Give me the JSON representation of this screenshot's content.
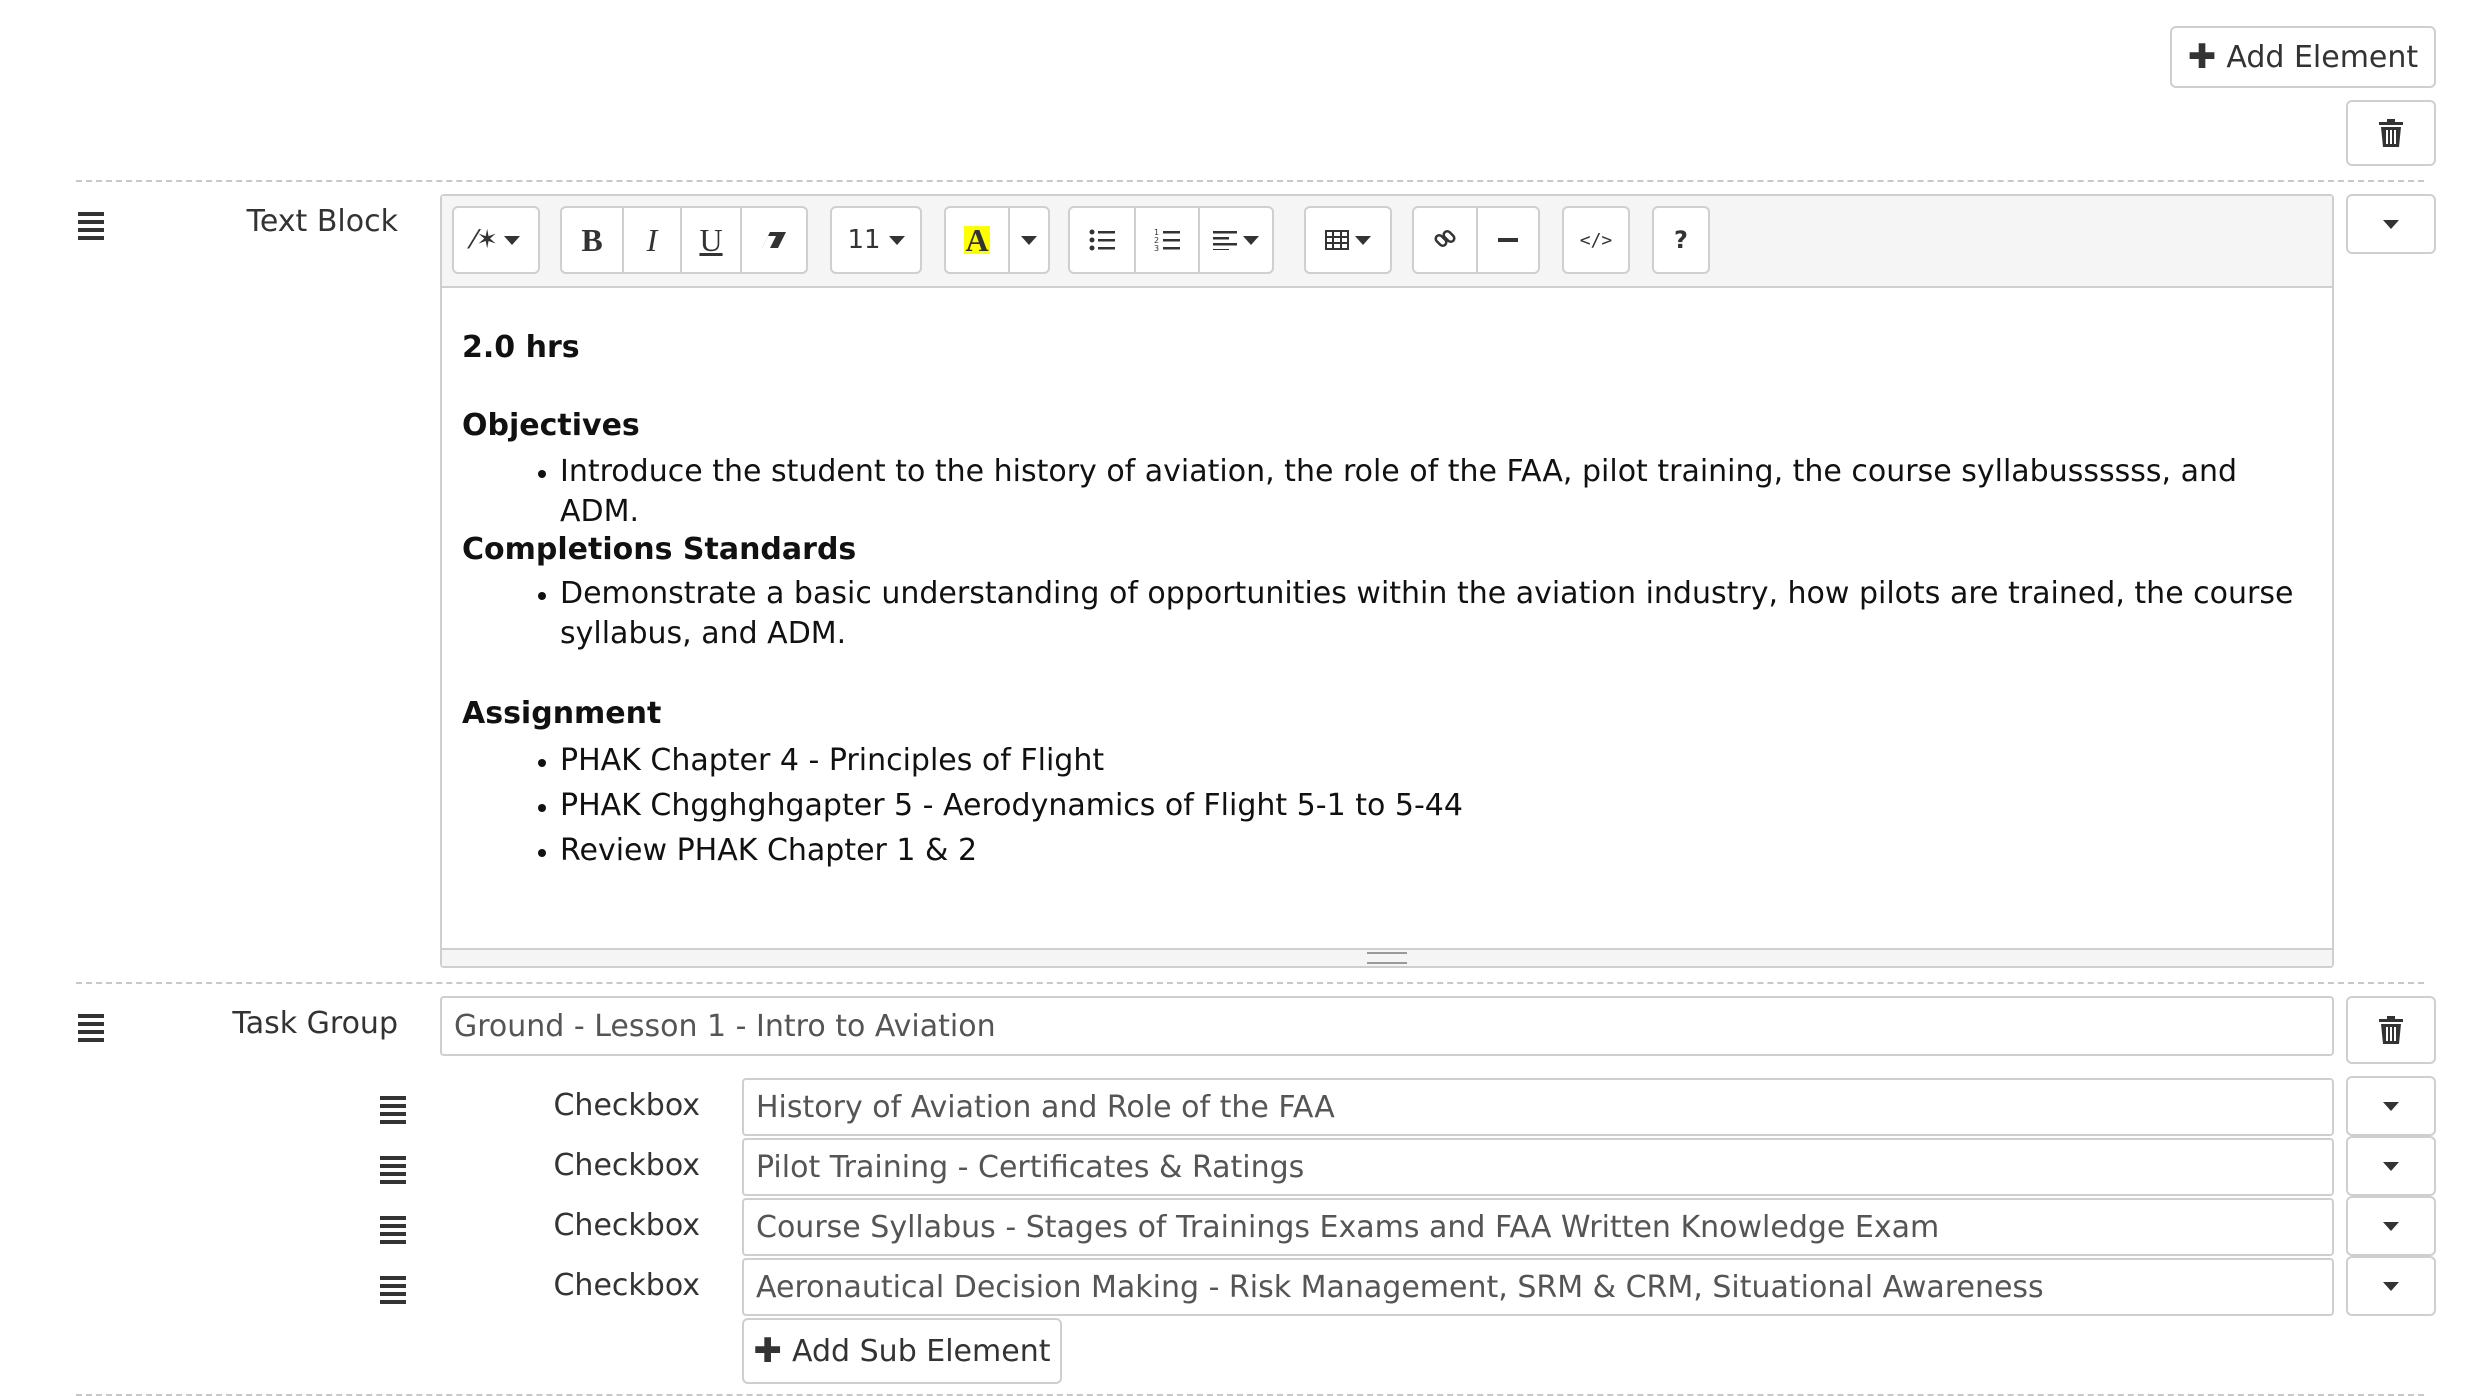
{
  "top": {
    "add_element_label": "Add Element"
  },
  "text_block": {
    "label": "Text Block",
    "toolbar": {
      "font_size": "11",
      "highlight_letter": "A",
      "help_label": "?"
    },
    "content": {
      "duration": "2.0 hrs",
      "objectives_heading": "Objectives",
      "objectives": [
        "Introduce the student to the history of aviation, the role of the FAA, pilot training, the course syllabussssss, and ADM."
      ],
      "standards_heading": "Completions Standards",
      "standards": [
        "Demonstrate a basic understanding of opportunities within the aviation industry, how pilots are trained, the course syllabus, and ADM."
      ],
      "assignment_heading": "Assignment",
      "assignments": [
        "PHAK Chapter 4 - Principles of Flight",
        "PHAK Chgghghgapter 5 - Aerodynamics of Flight 5-1 to 5-44",
        "Review PHAK Chapter 1 & 2"
      ]
    }
  },
  "task_group": {
    "label": "Task Group",
    "value": "Ground - Lesson 1 - Intro to Aviation",
    "checkboxes": [
      {
        "label": "Checkbox",
        "value": "History of Aviation and Role of the FAA"
      },
      {
        "label": "Checkbox",
        "value": "Pilot Training - Certificates & Ratings"
      },
      {
        "label": "Checkbox",
        "value": "Course Syllabus - Stages of Trainings Exams and FAA Written Knowledge Exam"
      },
      {
        "label": "Checkbox",
        "value": "Aeronautical Decision Making - Risk Management, SRM & CRM, Situational Awareness"
      }
    ],
    "add_sub_element_label": "Add Sub Element"
  },
  "icons": {
    "add": "plus-icon",
    "delete": "trash-icon",
    "handle": "drag-handle-icon",
    "menu": "caret-down-icon"
  },
  "colors": {
    "border": "#cfcfcf",
    "text": "#333333",
    "highlight": "#ffff00"
  }
}
